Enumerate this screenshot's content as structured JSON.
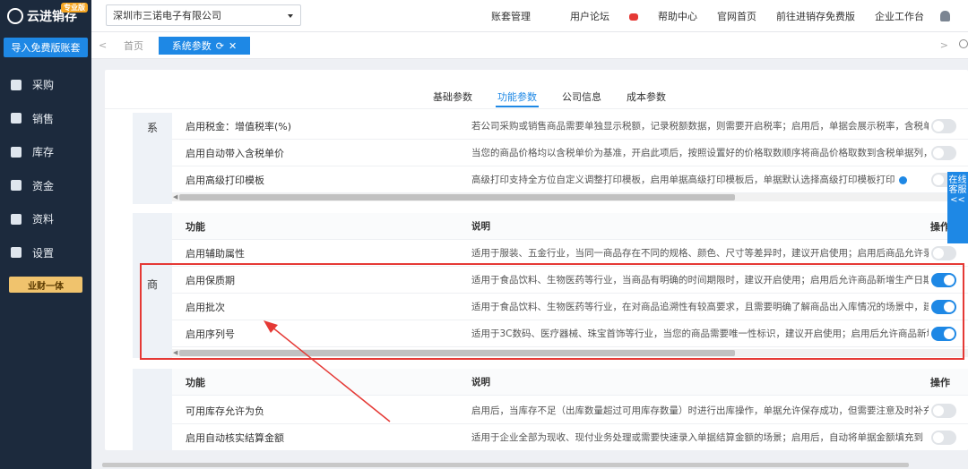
{
  "app": {
    "name": "云进销存",
    "edition_badge": "专业版"
  },
  "sidebar": {
    "import_button": "导入免费版账套",
    "items": [
      {
        "label": "采购",
        "icon": "bag-icon"
      },
      {
        "label": "销售",
        "icon": "sales-icon"
      },
      {
        "label": "库存",
        "icon": "warehouse-icon"
      },
      {
        "label": "资金",
        "icon": "money-icon"
      },
      {
        "label": "资料",
        "icon": "document-icon"
      },
      {
        "label": "设置",
        "icon": "gear-icon"
      }
    ],
    "promo_button": "业财一体"
  },
  "header": {
    "company": "深圳市三诺电子有限公司",
    "links": [
      "账套管理",
      "用户论坛",
      "帮助中心",
      "官网首页",
      "前往进销存免费版",
      "企业工作台"
    ]
  },
  "tabs": {
    "home": "首页",
    "active": "系统参数"
  },
  "subtabs": [
    {
      "label": "基础参数",
      "active": false
    },
    {
      "label": "功能参数",
      "active": true
    },
    {
      "label": "公司信息",
      "active": false
    },
    {
      "label": "成本参数",
      "active": false
    }
  ],
  "sections": [
    {
      "side_label": "系",
      "rows": [
        {
          "name": "启用税金：增值税率(%)",
          "desc": "若公司采购或销售商品需要单独显示税额，记录税额数据，则需要开启税率；启用后，单据会展示税率，含税单价",
          "on": false
        },
        {
          "name": "启用自动带入含税单价",
          "desc": "当您的商品价格均以含税单价为基准，开启此项后，按照设置好的价格取数顺序将商品价格取数到含税单据列，如",
          "on": false
        },
        {
          "name": "启用高级打印模板",
          "desc": "高级打印支持全方位自定义调整打印模板，启用单据高级打印模板后，单据默认选择高级打印模板打印",
          "on": false
        }
      ]
    },
    {
      "side_label": "商",
      "header": {
        "name": "功能",
        "desc": "说明",
        "action": "操作"
      },
      "rows": [
        {
          "name": "启用辅助属性",
          "desc": "适用于服装、五金行业，当同一商品存在不同的规格、颜色、尺寸等差异时，建议开启使用；启用后商品允许录入",
          "on": false
        },
        {
          "name": "启用保质期",
          "desc": "适用于食品饮料、生物医药等行业，当商品有明确的时间期限时，建议开启使用；启用后允许商品新增生产日期、",
          "on": true
        },
        {
          "name": "启用批次",
          "desc": "适用于食品饮料、生物医药等行业，在对商品追溯性有较高要求，且需要明确了解商品出入库情况的场景中，建议开",
          "on": true
        },
        {
          "name": "启用序列号",
          "desc": "适用于3C数码、医疗器械、珠宝首饰等行业，当您的商品需要唯一性标识，建议开启使用；启用后允许商品新增",
          "on": true
        }
      ]
    },
    {
      "side_label": "",
      "header": {
        "name": "功能",
        "desc": "说明",
        "action": "操作"
      },
      "rows": [
        {
          "name": "可用库存允许为负",
          "desc": "启用后，当库存不足（出库数量超过可用库存数量）时进行出库操作，单据允许保存成功，但需要注意及时补充",
          "on": false
        },
        {
          "name": "启用自动核实结算金额",
          "desc": "适用于企业全部为现收、现付业务处理或需要快速录入单据结算金额的场景；启用后，自动将单据金额填充到",
          "on": false
        }
      ]
    }
  ],
  "support_tab": "在线客服<<"
}
